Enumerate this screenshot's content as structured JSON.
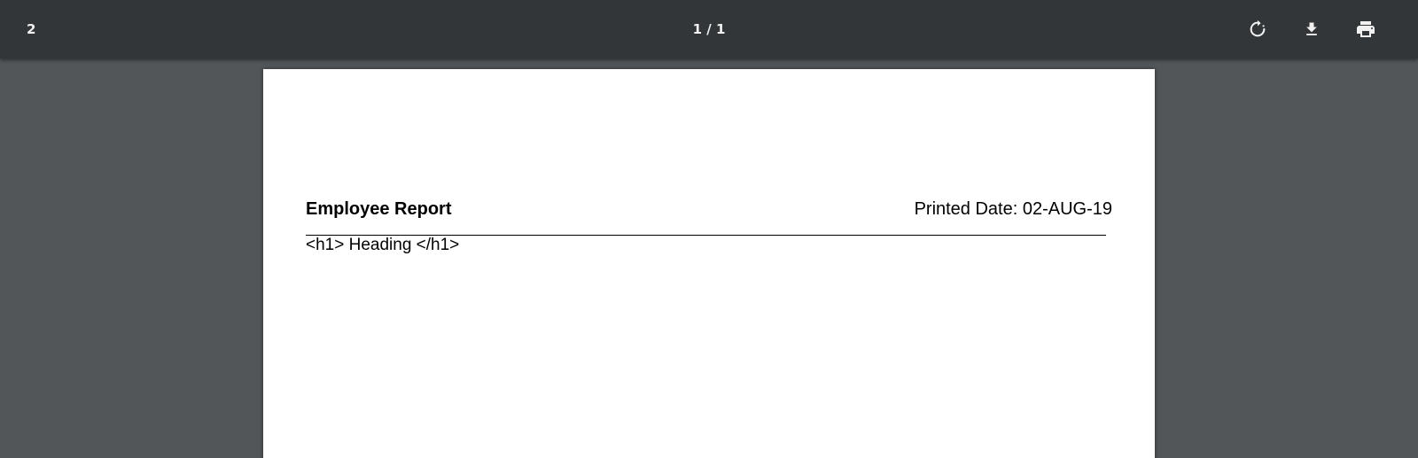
{
  "toolbar": {
    "title": "2",
    "page_indicator": "1 / 1",
    "icons": {
      "rotate": "rotate-icon",
      "download": "download-icon",
      "print": "print-icon"
    }
  },
  "document": {
    "report_title": "Employee Report",
    "printed_date": "Printed Date: 02-AUG-19",
    "heading_text": "<h1> Heading </h1>"
  },
  "colors": {
    "toolbar_bg": "#323639",
    "viewer_bg": "#525659",
    "page_bg": "#ffffff",
    "toolbar_text": "#f1f1f1"
  }
}
